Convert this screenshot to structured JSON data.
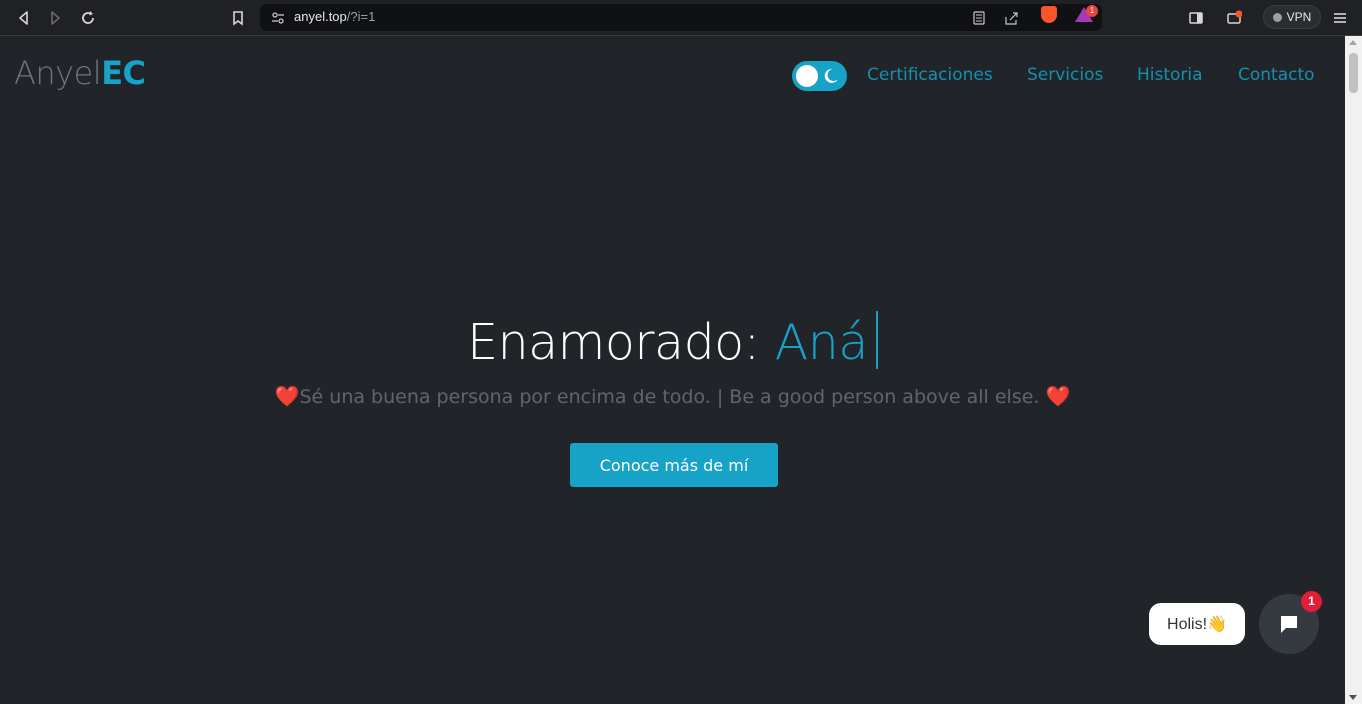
{
  "browser": {
    "url_host": "anyel.top",
    "url_path": "/?i=1",
    "rewards_badge": "1",
    "vpn_label": "VPN"
  },
  "site": {
    "logo_light": "Anyel",
    "logo_bold": "EC",
    "nav": [
      {
        "label": "Certificaciones"
      },
      {
        "label": "Servicios"
      },
      {
        "label": "Historia"
      },
      {
        "label": "Contacto"
      }
    ]
  },
  "hero": {
    "title_prefix": "Enamorado:",
    "title_typed": "Aná",
    "subtitle": "Sé una buena persona por encima de todo. | Be a good person above all else.",
    "heart_left": "❤️",
    "heart_right": "❤️",
    "cta_label": "Conoce más de mí"
  },
  "chat": {
    "greeting": "Holis!👋",
    "unread_count": "1"
  },
  "colors": {
    "accent": "#17a2c8",
    "background": "#212529",
    "nav_link": "#168fae"
  }
}
